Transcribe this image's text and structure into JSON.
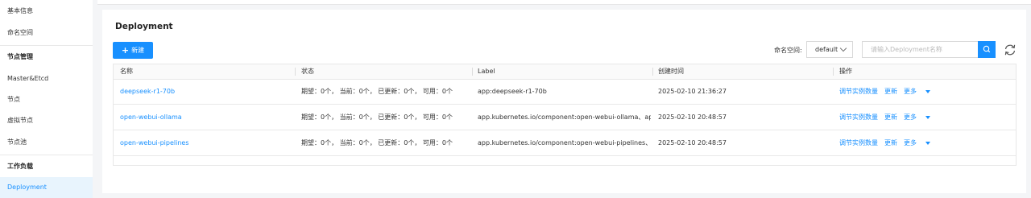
{
  "sidebar": {
    "items": [
      {
        "label": "基本信息"
      },
      {
        "label": "命名空间"
      },
      {
        "label": "节点管理"
      },
      {
        "label": "Master&Etcd"
      },
      {
        "label": "节点"
      },
      {
        "label": "虚拟节点"
      },
      {
        "label": "节点池"
      },
      {
        "label": "工作负载"
      },
      {
        "label": "Deployment"
      }
    ]
  },
  "main": {
    "title": "Deployment",
    "new_button": "新建",
    "namespace_label": "命名空间:",
    "namespace_value": "default",
    "search_placeholder": "请输入Deployment名称",
    "columns": [
      "名称",
      "状态",
      "Label",
      "创建时间",
      "操作"
    ],
    "rows": [
      {
        "name": "deepseek-r1-70b",
        "status": "期望：0个，  当前：0个，  已更新：0个，  可用：0个",
        "label": "app:deepseek-r1-70b",
        "created": "2025-02-10 21:36:27"
      },
      {
        "name": "open-webui-ollama",
        "status": "期望：0个，  当前：0个，  已更新：0个，  可用：0个",
        "label": "app.kubernetes.io/component:open-webui-ollama、app.",
        "created": "2025-02-10 20:48:57"
      },
      {
        "name": "open-webui-pipelines",
        "status": "期望：0个，  当前：0个，  已更新：0个，  可用：0个",
        "label": "app.kubernetes.io/component:open-webui-pipelines、ap",
        "created": "2025-02-10 20:48:57"
      }
    ],
    "actions": {
      "scale": "调节实例数量",
      "update": "更新",
      "more": "更多"
    }
  },
  "colors": {
    "accent": "#1890ff",
    "active_bg": "#e8f4fd"
  },
  "icons": {
    "new": "plus-icon",
    "search": "search-icon",
    "refresh": "refresh-icon",
    "select": "chevron-down-icon",
    "more": "caret-down-icon"
  }
}
